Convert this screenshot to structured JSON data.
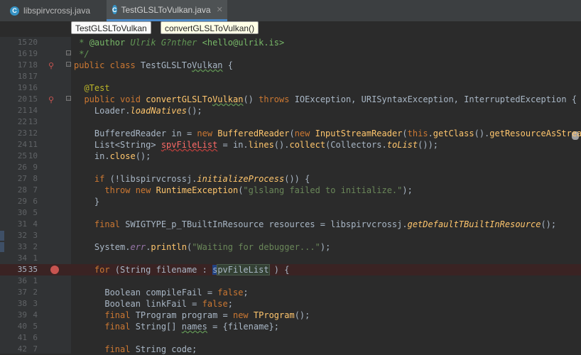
{
  "tabs": [
    {
      "icon": "C",
      "label": "libspirvcrossj.java",
      "active": false
    },
    {
      "icon": "C",
      "label": "TestGLSLToVulkan.java",
      "active": true
    }
  ],
  "breadcrumbs": [
    "TestGLSLToVulkan",
    "convertGLSLToVulkan()"
  ],
  "lines": [
    {
      "n1": "15",
      "n2": "20",
      "code": [
        [
          "cm",
          " * "
        ],
        [
          "cmt",
          "@author "
        ],
        [
          "cm",
          "Ulrik G?nther "
        ],
        [
          "cmt",
          "<hello@ulrik.is>"
        ]
      ]
    },
    {
      "n1": "16",
      "n2": "19",
      "code": [
        [
          "cm",
          " */"
        ]
      ]
    },
    {
      "n1": "17",
      "n2": "18",
      "code": [
        [
          "kw",
          "public class "
        ],
        [
          "",
          "TestGLSLTo"
        ],
        [
          "typo",
          "Vulkan"
        ],
        [
          "",
          " {"
        ]
      ]
    },
    {
      "n1": "18",
      "n2": "17",
      "code": []
    },
    {
      "n1": "19",
      "n2": "16",
      "code": [
        [
          "an",
          "  @Test"
        ]
      ]
    },
    {
      "n1": "20",
      "n2": "15",
      "code": [
        [
          "kw",
          "  public void "
        ],
        [
          "fn",
          "convertGLSLTo"
        ],
        [
          "fn typo",
          "Vulkan"
        ],
        [
          "",
          "() "
        ],
        [
          "kw",
          "throws "
        ],
        [
          "",
          "IOException, URISyntaxException, InterruptedException {"
        ]
      ]
    },
    {
      "n1": "21",
      "n2": "14",
      "code": [
        [
          "",
          "    Loader."
        ],
        [
          "sf",
          "loadNatives"
        ],
        [
          "",
          "();"
        ]
      ]
    },
    {
      "n1": "22",
      "n2": "13",
      "code": []
    },
    {
      "n1": "23",
      "n2": "12",
      "code": [
        [
          "",
          "    BufferedReader in = "
        ],
        [
          "kw",
          "new "
        ],
        [
          "fn",
          "BufferedReader"
        ],
        [
          "",
          "("
        ],
        [
          "kw",
          "new "
        ],
        [
          "fn",
          "InputStreamReader"
        ],
        [
          "",
          "("
        ],
        [
          "kw",
          "this"
        ],
        [
          "",
          "."
        ],
        [
          "fn",
          "getClass"
        ],
        [
          "",
          "()."
        ],
        [
          "fn",
          "getResourceAsStream"
        ],
        [
          "",
          "("
        ]
      ]
    },
    {
      "n1": "24",
      "n2": "11",
      "code": [
        [
          "",
          "    List<String> "
        ],
        [
          "err",
          "spvFileList"
        ],
        [
          "",
          " = in."
        ],
        [
          "fn",
          "lines"
        ],
        [
          "",
          "()."
        ],
        [
          "fn",
          "collect"
        ],
        [
          "",
          "(Collectors."
        ],
        [
          "sf",
          "toList"
        ],
        [
          "",
          "());"
        ]
      ]
    },
    {
      "n1": "25",
      "n2": "10",
      "code": [
        [
          "",
          "    in."
        ],
        [
          "fn",
          "close"
        ],
        [
          "",
          "();"
        ]
      ]
    },
    {
      "n1": "26",
      "n2": "9",
      "code": []
    },
    {
      "n1": "27",
      "n2": "8",
      "code": [
        [
          "kw",
          "    if "
        ],
        [
          "",
          "(!libspirvcrossj."
        ],
        [
          "sf",
          "initializeProcess"
        ],
        [
          "",
          "()) {"
        ]
      ]
    },
    {
      "n1": "28",
      "n2": "7",
      "code": [
        [
          "kw",
          "      throw new "
        ],
        [
          "fn",
          "RuntimeException"
        ],
        [
          "",
          "("
        ],
        [
          "st",
          "\"glslang failed to initialize.\""
        ],
        [
          "",
          ");"
        ]
      ]
    },
    {
      "n1": "29",
      "n2": "6",
      "code": [
        [
          "",
          "    }"
        ]
      ]
    },
    {
      "n1": "30",
      "n2": "5",
      "code": []
    },
    {
      "n1": "31",
      "n2": "4",
      "code": [
        [
          "kw",
          "    final "
        ],
        [
          "",
          "SWIGTYPE_p_TBuiltInResource resources = libspirvcrossj."
        ],
        [
          "sf",
          "getDefaultTBuiltInResource"
        ],
        [
          "",
          "();"
        ]
      ]
    },
    {
      "n1": "32",
      "n2": "3",
      "code": []
    },
    {
      "n1": "33",
      "n2": "2",
      "code": [
        [
          "",
          "    System."
        ],
        [
          "fld",
          "err"
        ],
        [
          "",
          "."
        ],
        [
          "fn",
          "println"
        ],
        [
          "",
          "("
        ],
        [
          "st",
          "\"Waiting for debugger...\""
        ],
        [
          "",
          ");"
        ]
      ]
    },
    {
      "n1": "34",
      "n2": "1",
      "code": []
    },
    {
      "n1": "35",
      "n2": "35",
      "bp": true,
      "code": [
        [
          "kw",
          "    for "
        ],
        [
          "",
          "(String filename : "
        ],
        [
          "caret",
          "s"
        ],
        [
          "hl",
          "pvFileList"
        ],
        [
          "",
          " ) {"
        ]
      ]
    },
    {
      "n1": "36",
      "n2": "1",
      "code": []
    },
    {
      "n1": "37",
      "n2": "2",
      "code": [
        [
          "",
          "      Boolean compileFail = "
        ],
        [
          "kw",
          "false"
        ],
        [
          "",
          ";"
        ]
      ]
    },
    {
      "n1": "38",
      "n2": "3",
      "code": [
        [
          "",
          "      Boolean linkFail = "
        ],
        [
          "kw",
          "false"
        ],
        [
          "",
          ";"
        ]
      ]
    },
    {
      "n1": "39",
      "n2": "4",
      "code": [
        [
          "kw",
          "      final "
        ],
        [
          "",
          "TProgram program = "
        ],
        [
          "kw",
          "new "
        ],
        [
          "fn",
          "TProgram"
        ],
        [
          "",
          "();"
        ]
      ]
    },
    {
      "n1": "40",
      "n2": "5",
      "code": [
        [
          "kw",
          "      final "
        ],
        [
          "",
          "String[] "
        ],
        [
          "typo",
          "names"
        ],
        [
          "",
          " = {filename};"
        ]
      ]
    },
    {
      "n1": "41",
      "n2": "6",
      "code": []
    },
    {
      "n1": "42",
      "n2": "7",
      "code": [
        [
          "kw",
          "      final "
        ],
        [
          "",
          "String code;"
        ]
      ]
    }
  ]
}
